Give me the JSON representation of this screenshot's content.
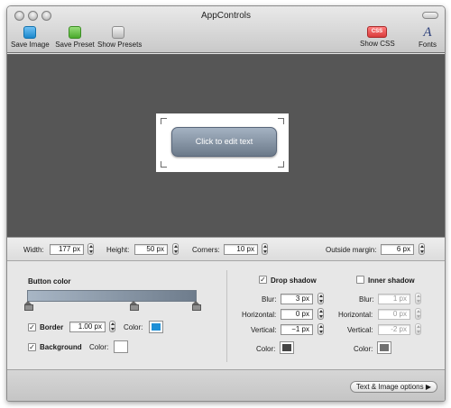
{
  "window": {
    "title": "AppControls"
  },
  "toolbar": {
    "save_image": "Save Image",
    "save_preset": "Save Preset",
    "show_presets": "Show Presets",
    "show_css": "Show CSS",
    "css_badge": "CSS",
    "fonts": "Fonts",
    "fonts_glyph": "A"
  },
  "preview": {
    "button_label": "Click to edit text"
  },
  "dimensions": {
    "width_label": "Width:",
    "width_value": "177 px",
    "height_label": "Height:",
    "height_value": "50 px",
    "corners_label": "Corners:",
    "corners_value": "10 px",
    "outside_margin_label": "Outside margin:",
    "outside_margin_value": "6 px"
  },
  "button_color": {
    "label": "Button color",
    "gradient_start": "#a8b6c5",
    "gradient_end": "#6e7c8c"
  },
  "border": {
    "label": "Border",
    "checked": true,
    "width_value": "1.00 px",
    "color_label": "Color:",
    "color": "#1e8fd6"
  },
  "background": {
    "label": "Background",
    "checked": true,
    "color_label": "Color:",
    "color": "#ffffff"
  },
  "drop_shadow": {
    "label": "Drop shadow",
    "checked": true,
    "blur_label": "Blur:",
    "blur_value": "3 px",
    "horizontal_label": "Horizontal:",
    "horizontal_value": "0 px",
    "vertical_label": "Vertical:",
    "vertical_value": "−1 px",
    "color_label": "Color:",
    "color": "#444444"
  },
  "inner_shadow": {
    "label": "Inner shadow",
    "checked": false,
    "blur_label": "Blur:",
    "blur_value": "1 px",
    "horizontal_label": "Horizontal:",
    "horizontal_value": "0 px",
    "vertical_label": "Vertical:",
    "vertical_value": "-2 px",
    "color_label": "Color:",
    "color": "#707070"
  },
  "bottom": {
    "options_button": "Text & Image options ▶"
  }
}
